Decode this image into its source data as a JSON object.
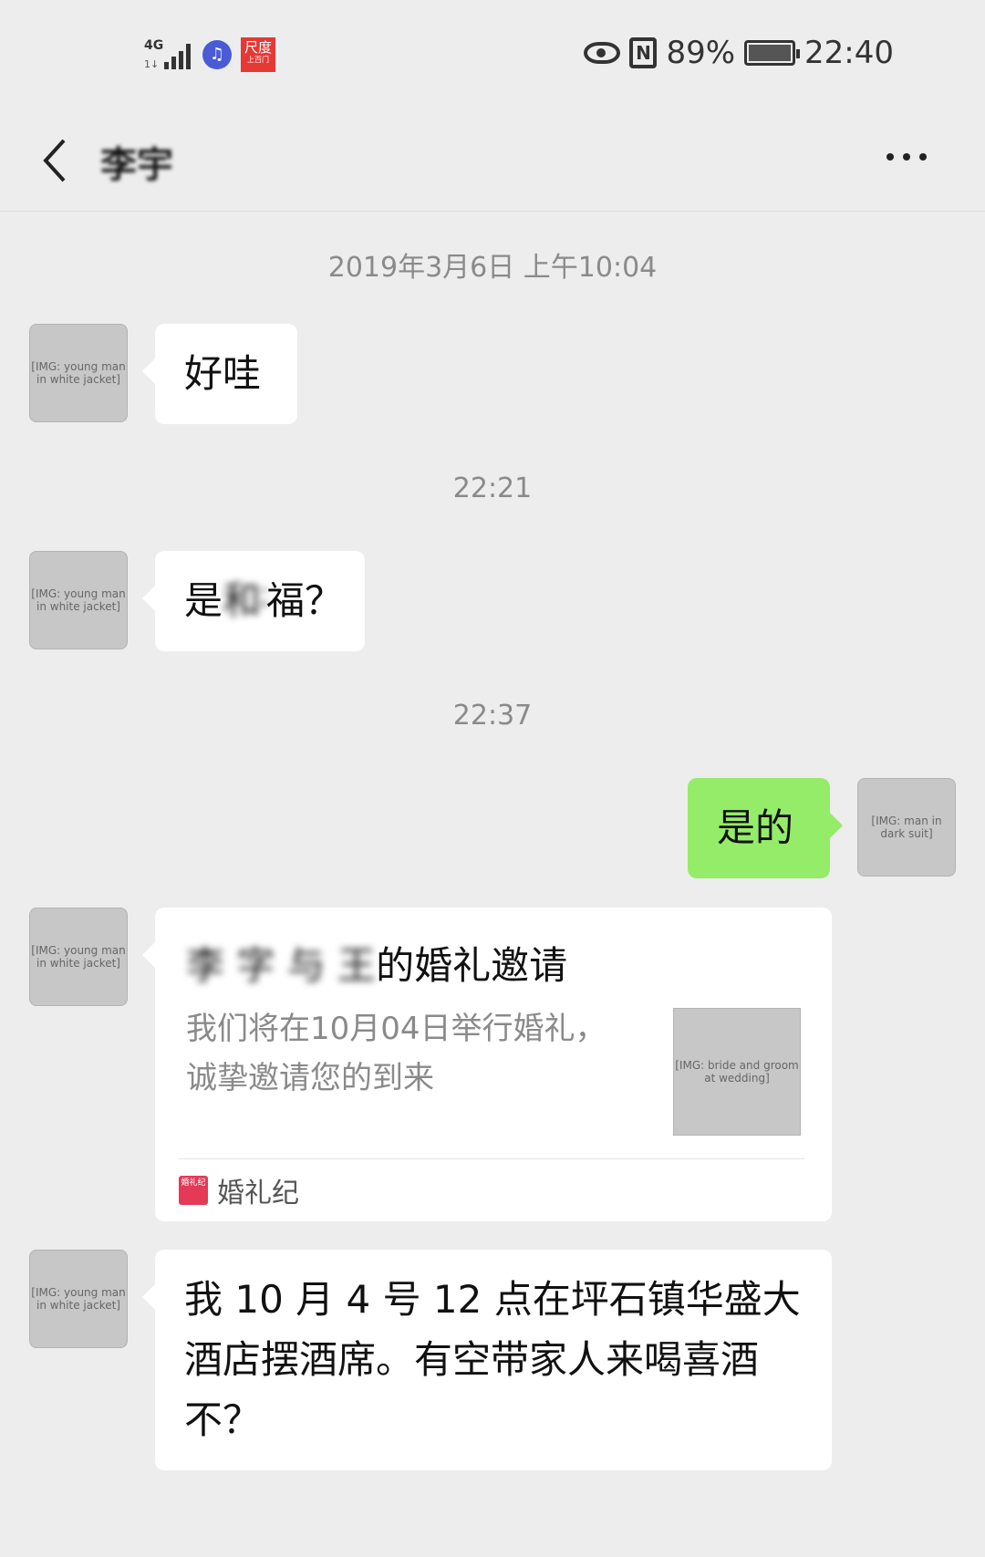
{
  "status_bar": {
    "network": "4G",
    "battery_percent": "89%",
    "time": "22:40",
    "icons": [
      "signal-icon",
      "music-app-icon",
      "baidu-app-icon",
      "eye-icon",
      "nfc-icon",
      "battery-icon"
    ]
  },
  "nav": {
    "title": "李宇",
    "back_icon": "chevron-left-icon",
    "more_icon": "more-icon"
  },
  "messages": {
    "ts1": "2019年3月6日 上午10:04",
    "m1": "好哇",
    "ts2": "22:21",
    "m2_pre": "是",
    "m2_blur": "和福",
    "m2_post": "福？",
    "ts3": "22:37",
    "m3": "是的",
    "card": {
      "title_blur": "李 字 与 王",
      "title_tail": "的婚礼邀请",
      "desc": "我们将在10月04日举行婚礼，诚挚邀请您的到来",
      "source": "婚礼纪"
    },
    "m5": "我 10 月 4 号 12 点在坪石镇华盛大酒店摆酒席。有空带家人来喝喜酒不？"
  },
  "colors": {
    "background": "#ededed",
    "bubble_in": "#ffffff",
    "bubble_out": "#95ec69",
    "timestamp": "#8a8a8a"
  }
}
